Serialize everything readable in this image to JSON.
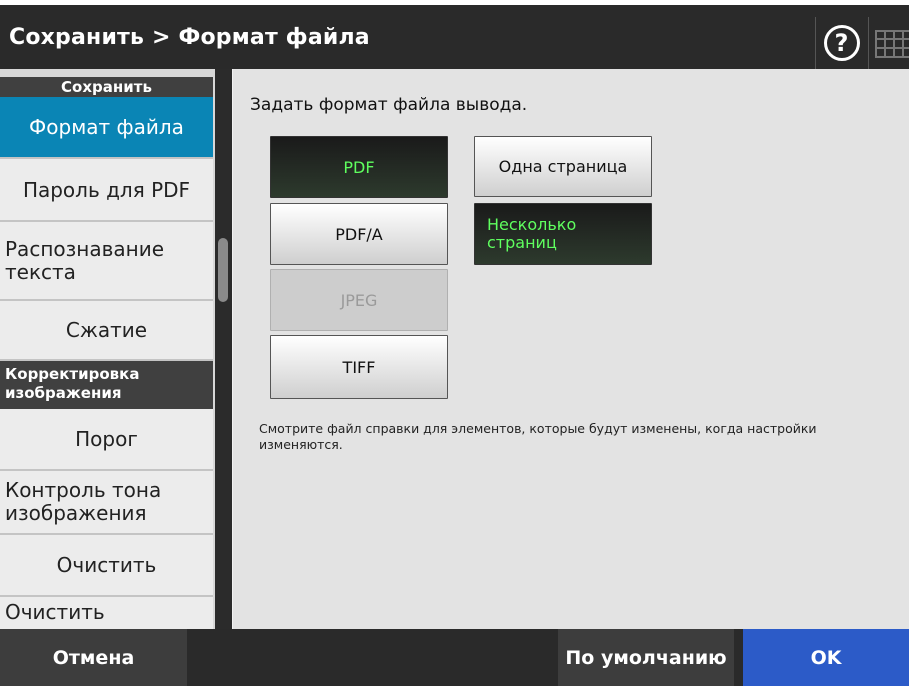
{
  "header": {
    "title": "Сохранить > Формат файла",
    "help_label": "?",
    "help_icon": "help-icon",
    "keyboard_icon": "keyboard-icon"
  },
  "sidebar": {
    "sections": [
      {
        "title": "Сохранить",
        "items": [
          {
            "label": "Формат файла",
            "active": true
          },
          {
            "label": "Пароль для PDF",
            "active": false
          },
          {
            "label": "Распознавание текста",
            "active": false
          },
          {
            "label": "Сжатие",
            "active": false
          }
        ]
      },
      {
        "title": "Корректировка изображения",
        "items": [
          {
            "label": "Порог",
            "active": false
          },
          {
            "label": "Контроль тона изображения",
            "active": false
          },
          {
            "label": "Очистить",
            "active": false
          },
          {
            "label": "Очистить",
            "active": false
          }
        ]
      }
    ]
  },
  "main": {
    "instruction": "Задать формат файла вывода.",
    "formats": [
      {
        "label": "PDF",
        "state": "selected"
      },
      {
        "label": "PDF/A",
        "state": "normal"
      },
      {
        "label": "JPEG",
        "state": "disabled"
      },
      {
        "label": "TIFF",
        "state": "normal"
      }
    ],
    "page_options": [
      {
        "label": "Одна страница",
        "state": "normal"
      },
      {
        "label": "Несколько страниц",
        "state": "selected"
      }
    ],
    "note": "Смотрите файл справки для элементов, которые будут изменены, когда настройки изменяются."
  },
  "footer": {
    "cancel_label": "Отмена",
    "defaults_label": "По умолчанию",
    "ok_label": "OK"
  },
  "colors": {
    "header_bg": "#2a2a2a",
    "active_item": "#0a85b5",
    "selected_text": "#5fff5f",
    "ok_button": "#2c5bc8"
  }
}
